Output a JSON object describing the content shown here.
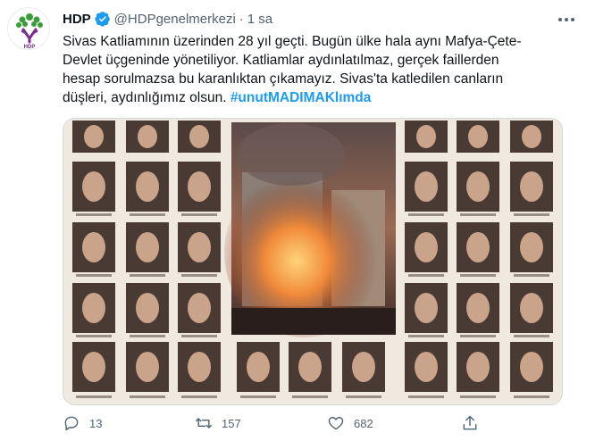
{
  "tweet": {
    "display_name": "HDP",
    "handle": "@HDPgenelmerkezi",
    "separator": "·",
    "time": "1 sa",
    "avatar_logo_text": "HDP",
    "text_line1": "Sivas Katliamının üzerinden 28 yıl geçti. Bugün ülke hala aynı Mafya-Çete-",
    "text_line2": "Devlet üçgeninde yönetiliyor. Katliamlar aydınlatılmaz, gerçek faillerden",
    "text_line3": "hesap sorulmazsa bu karanlıktan çıkamayız. Sivas'ta katledilen canların",
    "text_line4_prefix": "düşleri, aydınlığımız olsun. ",
    "hashtag": "#unutMADIMAKlımda",
    "replies": "13",
    "retweets": "157",
    "likes": "682"
  },
  "colors": {
    "accent": "#1d9bf0",
    "muted": "#536471",
    "hdp_purple": "#7b2d8e",
    "hdp_green": "#3a9c3a",
    "fire": "#e0622a"
  },
  "icons": {
    "verified": "verified-badge-icon",
    "more": "more-options-icon",
    "reply": "reply-icon",
    "retweet": "retweet-icon",
    "like": "heart-icon",
    "share": "share-icon"
  },
  "image": {
    "description_visible": "memorial collage of victim portraits around a burning building photo"
  }
}
